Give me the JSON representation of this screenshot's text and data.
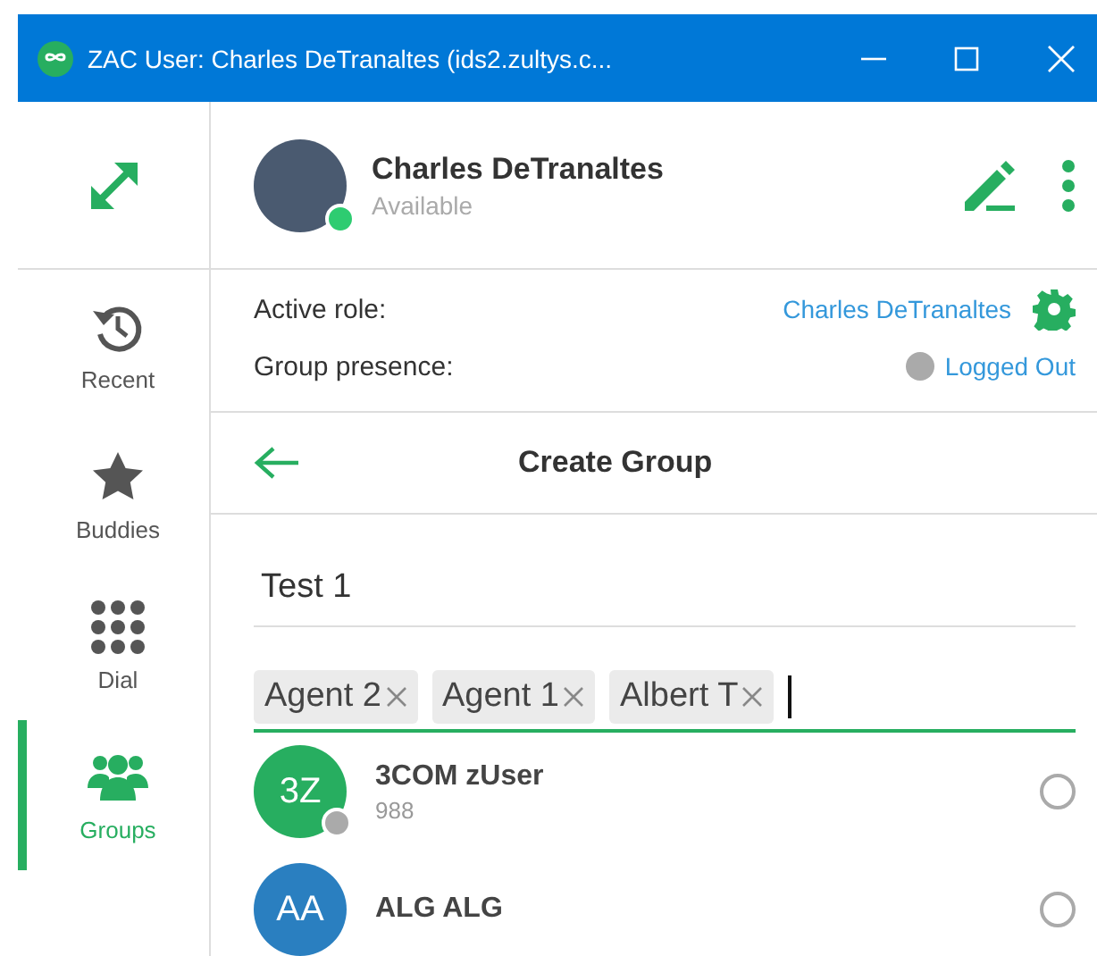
{
  "window": {
    "title": "ZAC User: Charles DeTranaltes (ids2.zultys.c..."
  },
  "profile": {
    "name": "Charles DeTranaltes",
    "status": "Available",
    "online": true
  },
  "sidebar": {
    "items": [
      {
        "kind": "recent",
        "label": "Recent",
        "selected": false
      },
      {
        "kind": "buddies",
        "label": "Buddies",
        "selected": false
      },
      {
        "kind": "dial",
        "label": "Dial",
        "selected": false
      },
      {
        "kind": "groups",
        "label": "Groups",
        "selected": true
      }
    ]
  },
  "role": {
    "label": "Active role:",
    "value": "Charles DeTranaltes"
  },
  "group_presence": {
    "label": "Group presence:",
    "value": "Logged Out",
    "color": "#aaaaaa"
  },
  "panel": {
    "title": "Create Group"
  },
  "group_name": {
    "value": "Test 1"
  },
  "members": {
    "tags": [
      "Agent 2",
      "Agent 1",
      "Albert T"
    ]
  },
  "contacts": [
    {
      "initials": "3Z",
      "name": "3COM zUser",
      "number": "988",
      "color": "#27ae60",
      "online": false,
      "selected": false
    },
    {
      "initials": "AA",
      "name": "ALG ALG",
      "color": "#2a7fc0",
      "selected": false
    }
  ]
}
